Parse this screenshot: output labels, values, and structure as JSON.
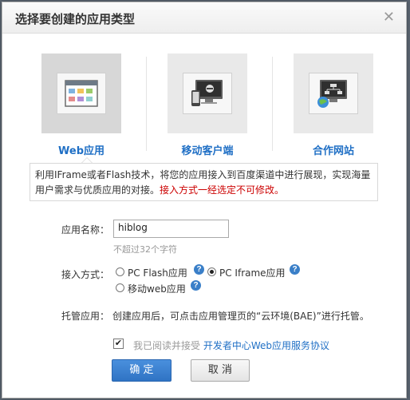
{
  "dialog": {
    "title": "选择要创建的应用类型",
    "close_glyph": "✕"
  },
  "app_types": [
    {
      "label": "Web应用",
      "icon": "web-window-icon",
      "selected": true
    },
    {
      "label": "移动客户端",
      "icon": "mobile-monitor-icon",
      "selected": false
    },
    {
      "label": "合作网站",
      "icon": "network-site-icon",
      "selected": false
    }
  ],
  "description": {
    "text": "利用IFrame或者Flash技术，将您的应用接入到百度渠道中进行展现，实现海量用户需求与优质应用的对接。",
    "warning": "接入方式一经选定不可修改。"
  },
  "form": {
    "name_label": "应用名称：",
    "name_value": "hiblog",
    "name_hint": "不超过32个字符",
    "access_label": "接入方式：",
    "access_options": [
      {
        "label": "PC Flash应用",
        "checked": false
      },
      {
        "label": "PC Iframe应用",
        "checked": true
      },
      {
        "label": "移动web应用",
        "checked": false
      }
    ],
    "hosting_label": "托管应用：",
    "hosting_text": "创建应用后，可点击应用管理页的“云环境(BAE)”进行托管。",
    "agree_text": "我已阅读并接受",
    "agree_link": "开发者中心Web应用服务协议",
    "agree_checked": true
  },
  "buttons": {
    "ok": "确 定",
    "cancel": "取 消"
  },
  "help_glyph": "?",
  "check_glyph": "✔"
}
